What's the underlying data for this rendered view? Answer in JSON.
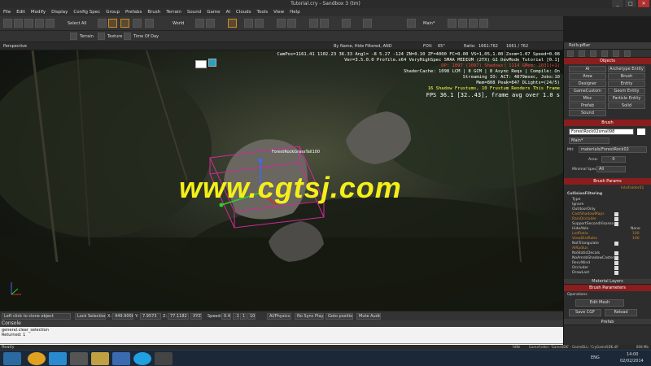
{
  "window": {
    "title": "Tutorial.cry - Sandbox 3 (tm)",
    "min": "_",
    "max": "□",
    "close": "✕"
  },
  "menu": [
    "File",
    "Edit",
    "Modify",
    "Display",
    "Config Spec",
    "Group",
    "Prefabs",
    "Brush",
    "Terrain",
    "Sound",
    "Game",
    "AI",
    "Clouds",
    "Tools",
    "View",
    "Help"
  ],
  "toolbar": {
    "select_all": "Select All",
    "world": "World",
    "layer": "Main*",
    "terrain": "Terrain",
    "texture": "Texture",
    "time_of_day": "Time Of Day"
  },
  "viewport": {
    "label": "Perspective",
    "search": "By Name, Hide Filtered, AND",
    "fov_label": "FOV:",
    "fov": "65°",
    "ratio_label": "Ratio:",
    "ratio": "1661:762",
    "res": "1661 / 762",
    "hud": [
      {
        "text": "CamPos=1161.41 1102.23 36.33 Angl= -8 5.27 -124 ZN=0.10 ZF=4000 FC=0.00 VS=1,05,1.00 Zoom=1.07 Speed=0.08",
        "color": "#ffffff"
      },
      {
        "text": "Ver=3.5.0.0 Profile.x64 VeryHighSpec SMAA MEDIUM (2TX) GI DevMode Tutorial [0.1]",
        "color": "#ffffff"
      },
      {
        "text": "DP: 1097 (1097) Shadows: 1114 GMem: 1031(+1)",
        "color": "#ff4040"
      },
      {
        "text": "ShaderCache: 1098 LCM | 8 GCM | 8 Async Reqs | Compile: On",
        "color": "#ffffff"
      },
      {
        "text": "Streaming IO: ACT: 4879msec, Jobs:10",
        "color": "#ffffff"
      },
      {
        "text": "Mem=808 Peak=847 DLights=(24/5)",
        "color": "#ffffff"
      },
      {
        "text": "16 Shadow Frustums, 10 Frustum Renders This Frame",
        "color": "#ffff40"
      },
      {
        "text": "FPS 36.1 [32..43], frame avg over 1.0 s",
        "color": "#ffffff"
      }
    ],
    "selected_object": "ForestRockGrassTall100",
    "watermark": "www.cgtsj.com"
  },
  "statusrow": {
    "hint": "Left click to clone object",
    "lock": "Lock Selection",
    "x_label": "X:",
    "x": "449.9008",
    "y_label": "Y:",
    "y": "7.9573",
    "z_label": "Z:",
    "z": "77.1182",
    "xyz": "XYZ",
    "speed_label": "Speed:",
    "speed": "0.4",
    "s1": ".1",
    "s2": "1",
    "s3": "10",
    "physics": "AI/Physics",
    "sync": "No Sync Player",
    "goto": "Goto position",
    "mute": "Mute Audio"
  },
  "console": {
    "title": "Console",
    "lines": [
      "general.clear_selection",
      "Returned: 1"
    ]
  },
  "rollup": {
    "title": "RollupBar",
    "objects_header": "Objects",
    "objects": [
      "AI",
      "Archetype Entity",
      "Area",
      "Brush",
      "Designer",
      "Entity",
      "GameCustom",
      "Geom Entity",
      "Misc",
      "Particle Entity",
      "Prefab",
      "Solid",
      "Sound"
    ],
    "brush_header": "Brush",
    "brush_name": "ForestRock02small98",
    "layer": "Main*",
    "mtl_label": "Mtl:",
    "mtl": "materials/ForestRock02",
    "area_label": "Area:",
    "area_value": "0",
    "minspec_label": "Minimal Spec:",
    "minspec": "All",
    "params_header": "Brush Params",
    "params_value": "IntoFolder01",
    "collision_header": "CollisionFiltering",
    "params": [
      "Type",
      "Ignore",
      "OutdoorOnly",
      "CastShadowMaps",
      "RainOccluder",
      "SupportSecondVisarea",
      "HideAble",
      "LodRatio",
      "ViewDistRatio",
      "NotTriangulate",
      "AIRadius",
      "NoStaticDecals",
      "NoAmnbShadowCaster",
      "RecvWind",
      "Occluder",
      "DrawLast"
    ],
    "hideable_value": "None",
    "lodratio_value": "100",
    "viewdist_value": "100",
    "material_layers": "Material Layers",
    "brush_params2": "Brush Parameters",
    "operations": "Operations",
    "edit_mesh": "Edit Mesh",
    "save_cgf": "Save CGF",
    "reload": "Reload",
    "prefab": "Prefab"
  },
  "statusbar": {
    "ready": "Ready",
    "idle": "Idle",
    "info": "GameFolder: 'GameSDK' - GameDLL: 'CryGameSDK.dll'",
    "mem": "808 Mb"
  },
  "taskbar": {
    "lang": "ENG",
    "time": "14:00",
    "date": "02/02/2014"
  }
}
